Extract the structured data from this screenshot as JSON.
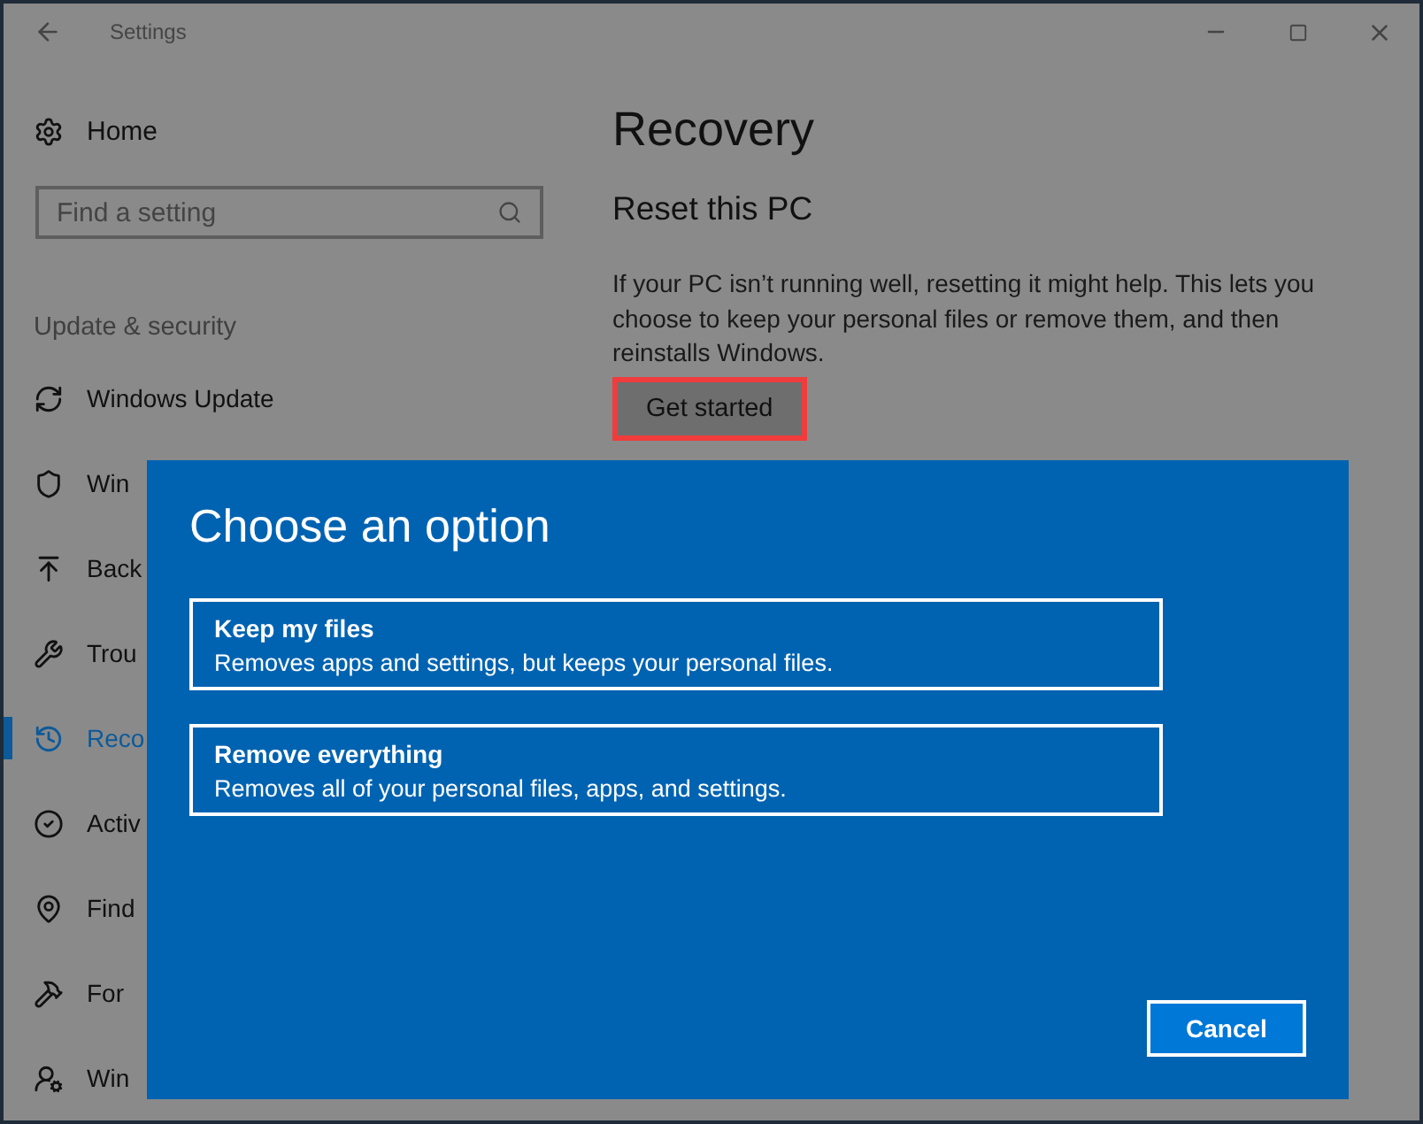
{
  "window": {
    "title": "Settings"
  },
  "sidebar": {
    "home": "Home",
    "search": {
      "placeholder": "Find a setting"
    },
    "section": "Update & security",
    "items": [
      {
        "label": "Windows Update",
        "selected": false
      },
      {
        "label": "Win",
        "selected": false
      },
      {
        "label": "Back",
        "selected": false
      },
      {
        "label": "Trou",
        "selected": false
      },
      {
        "label": "Reco",
        "selected": true
      },
      {
        "label": "Activ",
        "selected": false
      },
      {
        "label": "Find",
        "selected": false
      },
      {
        "label": "For",
        "selected": false
      },
      {
        "label": "Win",
        "selected": false
      }
    ]
  },
  "content": {
    "title": "Recovery",
    "section": "Reset this PC",
    "text": "If your PC isn’t running well, resetting it might help. This lets you choose to keep your personal files or remove them, and then reinstalls Windows.",
    "button": {
      "label": "Get started",
      "highlighted": true
    }
  },
  "dialog": {
    "title": "Choose an option",
    "options": [
      {
        "title": "Keep my files",
        "description": "Removes apps and settings, but keeps your personal files."
      },
      {
        "title": "Remove everything",
        "description": "Removes all of your personal files, apps, and settings."
      }
    ],
    "cancel": "Cancel"
  }
}
